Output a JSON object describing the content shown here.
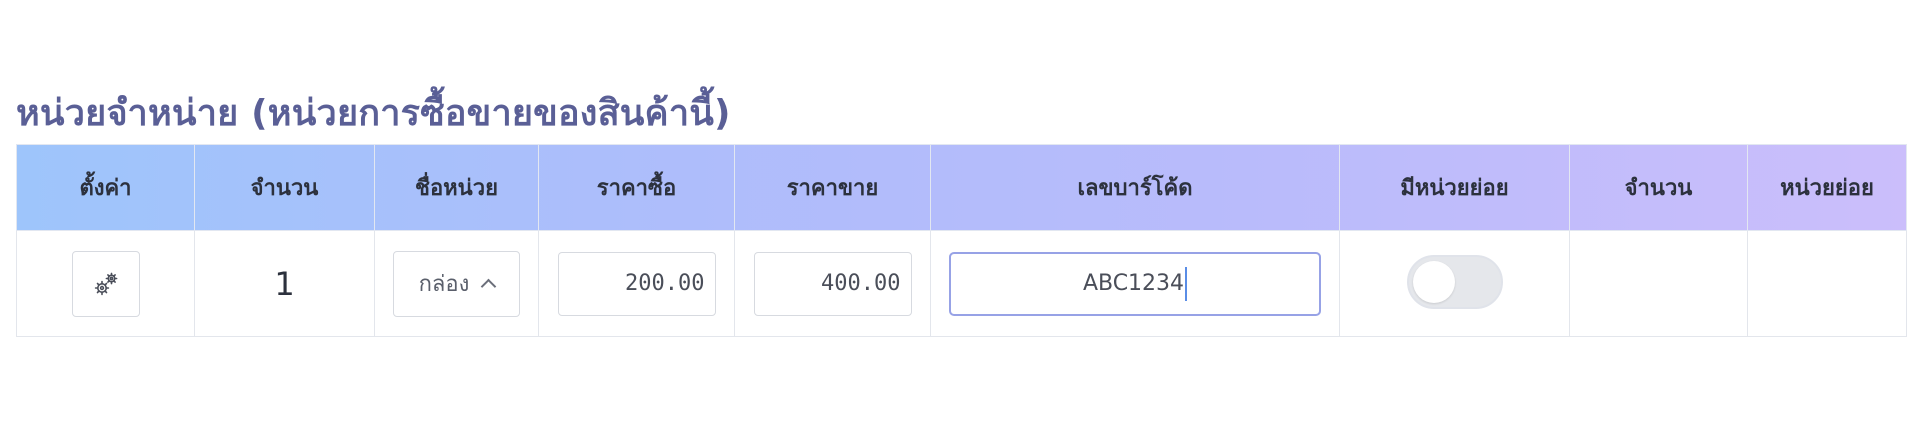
{
  "section": {
    "title": "หน่วยจำหน่าย (หน่วยการซื้อขายของสินค้านี้)"
  },
  "table": {
    "headers": {
      "settings": "ตั้งค่า",
      "quantity": "จำนวน",
      "unit_name": "ชื่อหน่วย",
      "buy_price": "ราคาซื้อ",
      "sell_price": "ราคาขาย",
      "barcode": "เลขบาร์โค้ด",
      "has_subunit": "มีหน่วยย่อย",
      "sub_quantity": "จำนวน",
      "subunit": "หน่วยย่อย"
    },
    "rows": [
      {
        "settings_icon": "gear-icon",
        "quantity": "1",
        "unit_name": "กล่อง",
        "unit_name_icon": "chevron-up-icon",
        "buy_price": "200.00",
        "sell_price": "400.00",
        "barcode": "ABC1234",
        "has_subunit": false,
        "sub_quantity": "",
        "subunit": ""
      }
    ]
  },
  "colors": {
    "title": "#5a5f96",
    "header_gradient_start": "#9ec5fb",
    "header_gradient_end": "#cbbefb",
    "focus_border": "#97a2e6",
    "toggle_off": "#e5e7eb"
  }
}
